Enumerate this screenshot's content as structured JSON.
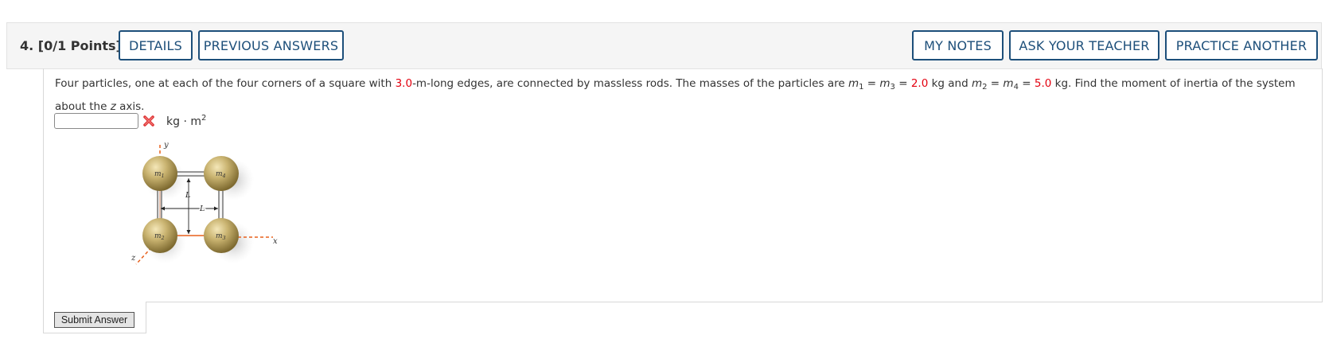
{
  "header": {
    "question_number": "4.",
    "points": "[0/1 Points]",
    "details_label": "DETAILS",
    "previous_answers_label": "PREVIOUS ANSWERS",
    "my_notes_label": "MY NOTES",
    "ask_teacher_label": "ASK YOUR TEACHER",
    "practice_another_label": "PRACTICE ANOTHER"
  },
  "question": {
    "t1": "Four particles, one at each of the four corners of a square with ",
    "edge_length": "3.0",
    "t2": "-m-long edges, are connected by massless rods. The masses of the particles are ",
    "m1_var": "m",
    "m1_sub": "1",
    "eq1": " = ",
    "m3_var": "m",
    "m3_sub": "3",
    "eq2": " = ",
    "mass_13": "2.0",
    "t3": " kg and ",
    "m2_var": "m",
    "m2_sub": "2",
    "eq3": " = ",
    "m4_var": "m",
    "m4_sub": "4",
    "eq4": " = ",
    "mass_24": "5.0",
    "t4": " kg. Find the moment of inertia of the system about the ",
    "axis_var": "z",
    "t5": " axis."
  },
  "answer": {
    "value": "",
    "status_icon": "incorrect-x-icon",
    "unit_base": "kg · m",
    "unit_exp": "2"
  },
  "figure": {
    "y_label": "y",
    "x_label": "x",
    "z_label": "z",
    "L_label": "L",
    "m1": "m",
    "m1s": "1",
    "m2": "m",
    "m2s": "2",
    "m3": "m",
    "m3s": "3",
    "m4": "m",
    "m4s": "4"
  },
  "submit_label": "Submit Answer",
  "colors": {
    "accent": "#1d4f7a",
    "value_red": "#e3000f",
    "axis_orange": "#e8601c",
    "sphere_gold": "#b09a56"
  }
}
